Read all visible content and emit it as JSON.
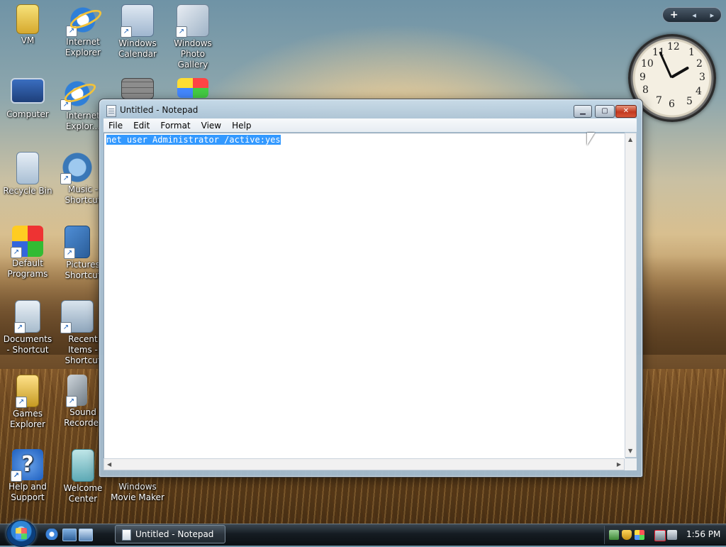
{
  "desktop": {
    "icons": [
      {
        "label": "VM"
      },
      {
        "label": "Internet Explorer"
      },
      {
        "label": "Windows Calendar"
      },
      {
        "label": "Windows Photo Gallery"
      },
      {
        "label": "Computer"
      },
      {
        "label": "Internet Explor..."
      },
      {
        "label": "Recycle Bin"
      },
      {
        "label": "Music - Shortcut"
      },
      {
        "label": "Default Programs"
      },
      {
        "label": "Pictures Shortcut"
      },
      {
        "label": "Documents - Shortcut"
      },
      {
        "label": "Recent Items - Shortcut"
      },
      {
        "label": "Games Explorer"
      },
      {
        "label": "Sound Recorder"
      },
      {
        "label": "Help and Support"
      },
      {
        "label": "Welcome Center"
      },
      {
        "label": "Windows Movie Maker"
      }
    ]
  },
  "sidebar": {
    "add_label": "+",
    "prev_label": "◂",
    "next_label": "▸",
    "clock_numbers": [
      "12",
      "1",
      "2",
      "3",
      "4",
      "5",
      "6",
      "7",
      "8",
      "9",
      "10",
      "11"
    ]
  },
  "notepad": {
    "title": "Untitled - Notepad",
    "menu": [
      "File",
      "Edit",
      "Format",
      "View",
      "Help"
    ],
    "content": "net user Administrator /active:yes",
    "content_selected": true
  },
  "taskbar": {
    "task_label": "Untitled - Notepad",
    "clock": "1:56 PM"
  }
}
